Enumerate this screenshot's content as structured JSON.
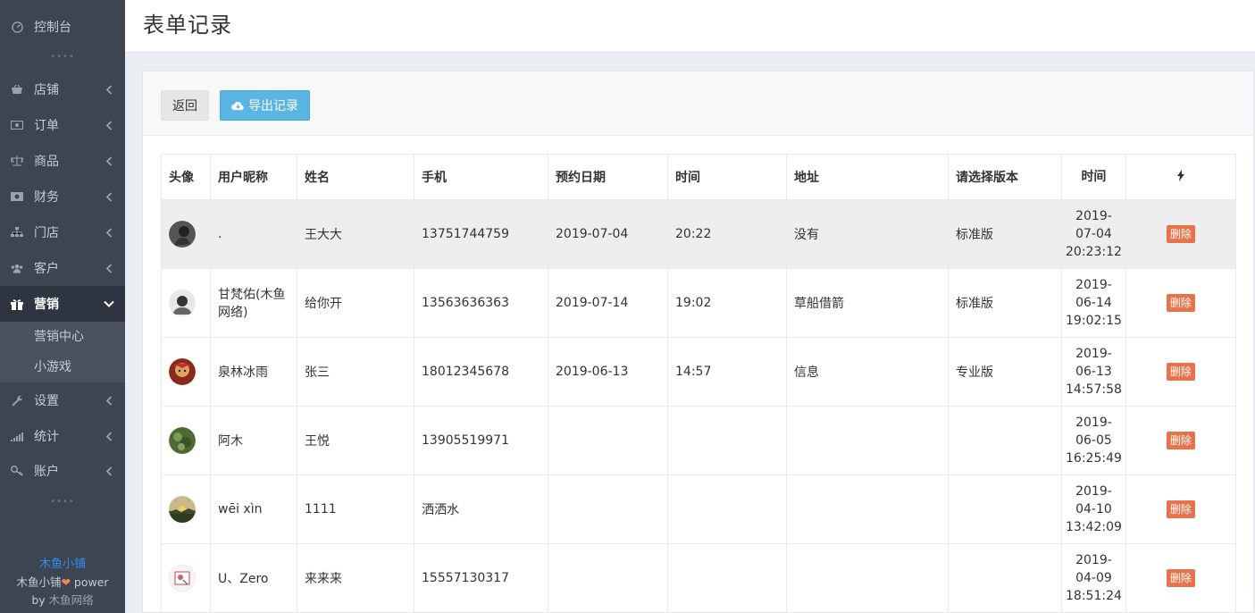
{
  "sidebar": {
    "items": [
      {
        "label": "控制台",
        "icon": "dashboard-icon"
      },
      {
        "label": "店铺",
        "icon": "basket-icon"
      },
      {
        "label": "订单",
        "icon": "money-icon"
      },
      {
        "label": "商品",
        "icon": "scale-icon"
      },
      {
        "label": "财务",
        "icon": "cash-icon"
      },
      {
        "label": "门店",
        "icon": "sitemap-icon"
      },
      {
        "label": "客户",
        "icon": "users-icon"
      },
      {
        "label": "营销",
        "icon": "gift-icon",
        "expanded": true
      },
      {
        "label": "设置",
        "icon": "wrench-icon"
      },
      {
        "label": "统计",
        "icon": "bar-chart-icon"
      },
      {
        "label": "账户",
        "icon": "key-icon"
      }
    ],
    "submenu": [
      "营销中心",
      "小游戏"
    ],
    "dots": "••••",
    "footer": {
      "brand": "木鱼小铺",
      "line2_prefix": "木鱼小铺",
      "heart": "❤",
      "line2_suffix": " power",
      "line3_prefix": "by ",
      "line3_company": "木鱼网络"
    }
  },
  "header": {
    "title": "表单记录"
  },
  "toolbar": {
    "back_label": "返回",
    "export_label": "导出记录"
  },
  "table": {
    "headers": [
      "头像",
      "用户昵称",
      "姓名",
      "手机",
      "预约日期",
      "时间",
      "地址",
      "请选择版本",
      "时间",
      ""
    ],
    "rows": [
      {
        "nickname": ".",
        "name": "王大大",
        "phone": "13751744759",
        "date": "2019-07-04",
        "time": "20:22",
        "address": "没有",
        "version": "标准版",
        "ts1": "2019-",
        "ts2": "07-04",
        "ts3": "20:23:12",
        "action": "删除"
      },
      {
        "nickname": "甘梵佑(木鱼网络)",
        "name": "给你开",
        "phone": "13563636363",
        "date": "2019-07-14",
        "time": "19:02",
        "address": "草船借箭",
        "version": "标准版",
        "ts1": "2019-",
        "ts2": "06-14",
        "ts3": "19:02:15",
        "action": "删除"
      },
      {
        "nickname": "泉林冰雨",
        "name": "张三",
        "phone": "18012345678",
        "date": "2019-06-13",
        "time": "14:57",
        "address": "信息",
        "version": "专业版",
        "ts1": "2019-",
        "ts2": "06-13",
        "ts3": "14:57:58",
        "action": "删除"
      },
      {
        "nickname": "阿木",
        "name": "王悦",
        "phone": "13905519971",
        "date": "",
        "time": "",
        "address": "",
        "version": "",
        "ts1": "2019-",
        "ts2": "06-05",
        "ts3": "16:25:49",
        "action": "删除"
      },
      {
        "nickname": "wēi xìn",
        "name": "1111",
        "phone": "洒洒水",
        "date": "",
        "time": "",
        "address": "",
        "version": "",
        "ts1": "2019-",
        "ts2": "04-10",
        "ts3": "13:42:09",
        "action": "删除"
      },
      {
        "nickname": "U、Zero",
        "name": "来来来",
        "phone": "15557130317",
        "date": "",
        "time": "",
        "address": "",
        "version": "",
        "ts1": "2019-",
        "ts2": "04-09",
        "ts3": "18:51:24",
        "action": "删除"
      }
    ]
  }
}
